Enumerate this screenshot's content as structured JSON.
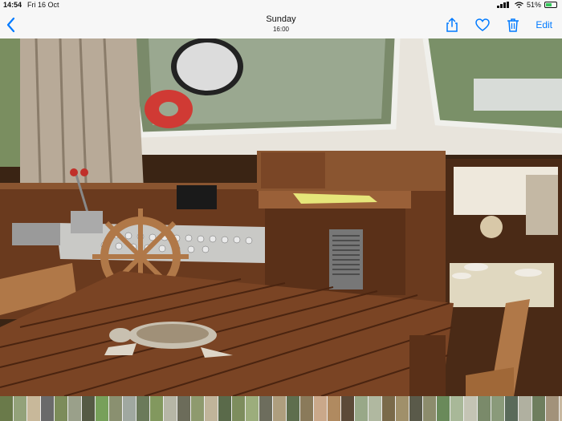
{
  "status": {
    "time": "14:54",
    "date": "Fri 16 Oct",
    "battery": "51%",
    "battery_level": 0.51
  },
  "nav": {
    "title": "Sunday",
    "subtitle": "16:00",
    "edit_label": "Edit",
    "icons": [
      "back-chevron-icon",
      "share-icon",
      "heart-icon",
      "trash-icon"
    ]
  },
  "colors": {
    "accent": "#007aff",
    "wood_dark": "#5a3018",
    "wood_mid": "#8a5530",
    "wood_light": "#b07040",
    "panel": "#c8c8c8"
  },
  "thumbnails": [
    "#6a7a4a",
    "#93a27a",
    "#c8b89a",
    "#6a6a6a",
    "#7c8c5a",
    "#9aa08a",
    "#555a44",
    "#77a05a",
    "#8a9070",
    "#a0a8a0",
    "#6b7a5a",
    "#82985e",
    "#b6b6a6",
    "#6c6c5a",
    "#8e9a6e",
    "#c0b49a",
    "#5a6a4a",
    "#7d8d5d",
    "#9cad7c",
    "#6d6d5d",
    "#ae9e7e",
    "#5e6e4e",
    "#8a7a5a",
    "#caa88a",
    "#b08a60",
    "#5c4a38",
    "#98a888",
    "#b0b8a0",
    "#7a6a4a",
    "#a0906a",
    "#5a5a4a",
    "#8c8c6c",
    "#6a8a5a",
    "#a8b898",
    "#c4c4b4",
    "#7a8a6a",
    "#8a9a7a",
    "#5a6a5a",
    "#b0b0a0",
    "#6e7e5e",
    "#a2927a",
    "#c8b8a0",
    "#88583a",
    "#a06c48",
    "#6a4a34",
    "#b88460",
    "#d4a070",
    "#8e6040",
    "#c89870",
    "#7c5434",
    "#a07050",
    "#d8b090"
  ]
}
